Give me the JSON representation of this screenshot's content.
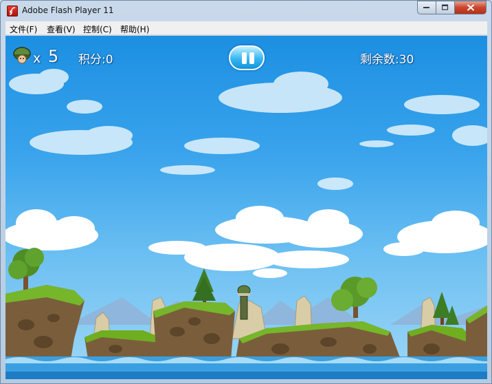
{
  "window": {
    "title": "Adobe Flash Player 11"
  },
  "menu": {
    "items": [
      {
        "label": "文件(F)"
      },
      {
        "label": "查看(V)"
      },
      {
        "label": "控制(C)"
      },
      {
        "label": "帮助(H)"
      }
    ]
  },
  "hud": {
    "lives_prefix": "x",
    "lives": "5",
    "score_label": "积分:0",
    "remaining_label": "剩余数:30"
  },
  "icons": {
    "app": "flash-icon",
    "lives": "soldier-helmet-icon",
    "pause": "pause-icon"
  },
  "colors": {
    "sky_top": "#1c8fe2",
    "grass": "#6fae1f",
    "water": "#3a9fe0"
  }
}
